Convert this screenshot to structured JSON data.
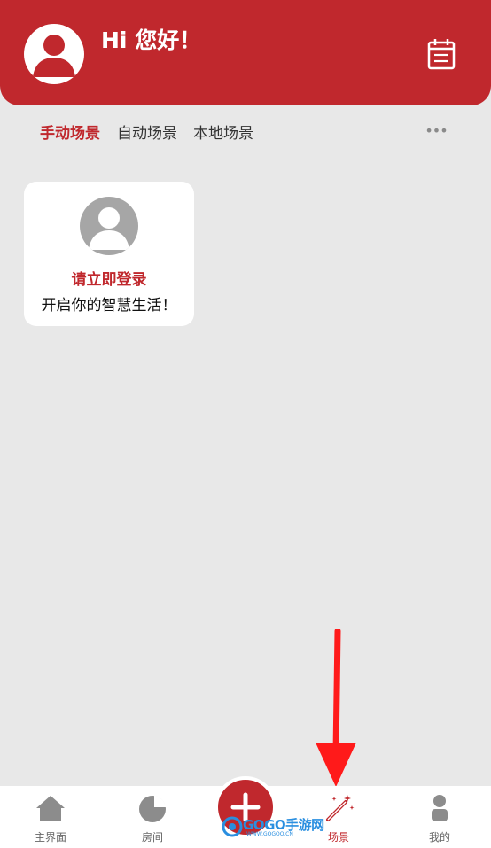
{
  "header": {
    "greeting": "Hi 您好！",
    "bg_color": "#c0282d",
    "avatar_icon": "user-silhouette-icon",
    "right_icon": "calendar-icon"
  },
  "tabs": [
    {
      "label": "手动场景",
      "active": true
    },
    {
      "label": "自动场景",
      "active": false
    },
    {
      "label": "本地场景",
      "active": false
    }
  ],
  "more_label": "•••",
  "login_card": {
    "title": "请立即登录",
    "subtitle": "开启你的智慧生活！"
  },
  "bottom_nav": {
    "items": [
      {
        "label": "主界面",
        "icon": "home-icon"
      },
      {
        "label": "房间",
        "icon": "pie-chart-icon"
      },
      {
        "label": "场景",
        "icon": "magic-wand-icon",
        "active": true
      },
      {
        "label": "我的",
        "icon": "person-icon"
      }
    ],
    "center_button_icon": "plus-icon"
  },
  "watermark": {
    "text": "GOGO手游网",
    "sub": "WWW.GOGOO.CN"
  },
  "accent_color": "#c0282d",
  "annotation_arrow_color": "#ff1a1a"
}
